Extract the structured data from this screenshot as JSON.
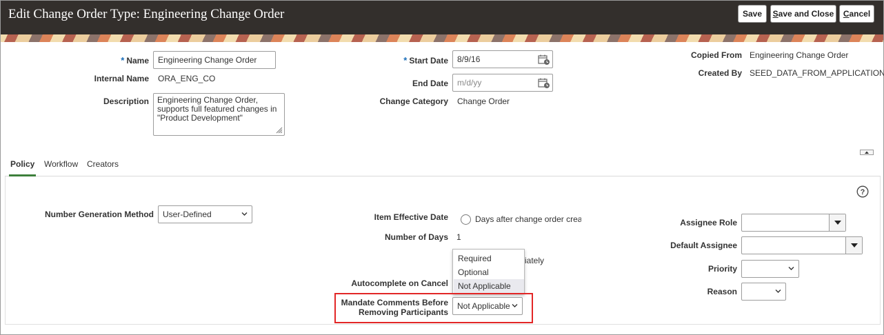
{
  "header": {
    "title": "Edit Change Order Type: Engineering Change Order",
    "buttons": {
      "save": "Save",
      "save_and_close": "Save and Close",
      "save_and_close_mnemonic": "S",
      "save_and_close_rest": "ave and Close",
      "cancel": "Cancel",
      "cancel_mnemonic": "C",
      "cancel_rest": "ancel"
    }
  },
  "form": {
    "name": {
      "label": "Name",
      "required_mark": "*",
      "value": "Engineering Change Order"
    },
    "internal_name": {
      "label": "Internal Name",
      "value": "ORA_ENG_CO"
    },
    "description": {
      "label": "Description",
      "value": "Engineering Change Order, supports full featured changes in \"Product Development\""
    },
    "start_date": {
      "label": "Start Date",
      "required_mark": "*",
      "value": "8/9/16"
    },
    "end_date": {
      "label": "End Date",
      "placeholder": "m/d/yy"
    },
    "change_category": {
      "label": "Change Category",
      "value": "Change Order"
    },
    "copied_from": {
      "label": "Copied From",
      "value": "Engineering Change Order"
    },
    "created_by": {
      "label": "Created By",
      "value": "SEED_DATA_FROM_APPLICATION"
    }
  },
  "tabs": [
    {
      "label": "Policy",
      "active": true
    },
    {
      "label": "Workflow",
      "active": false
    },
    {
      "label": "Creators",
      "active": false
    }
  ],
  "policy": {
    "number_generation_method": {
      "label": "Number Generation Method",
      "value": "User-Defined"
    },
    "item_effective_date": {
      "label": "Item Effective Date",
      "option_days_after": "Days after change order creatic",
      "option_immediately_fragment": "iately"
    },
    "number_of_days": {
      "label": "Number of Days",
      "value": "1"
    },
    "autocomplete_on_cancel": {
      "label": "Autocomplete on Cancel"
    },
    "mandate_comments": {
      "label_line1": "Mandate Comments Before",
      "label_line2": "Removing Participants",
      "value": "Not Applicable"
    },
    "dropdown_options": [
      "Required",
      "Optional",
      "Not Applicable"
    ],
    "dropdown_selected": "Not Applicable",
    "assignee_role": {
      "label": "Assignee Role",
      "value": ""
    },
    "default_assignee": {
      "label": "Default Assignee",
      "value": ""
    },
    "priority": {
      "label": "Priority",
      "value": ""
    },
    "reason": {
      "label": "Reason",
      "value": ""
    }
  },
  "colors": {
    "header_bg": "#332f2c",
    "required_mark": "#1b6fba",
    "active_tab_underline": "#3d7f3b",
    "highlight_border": "#e22626"
  },
  "icons": [
    "calendar-icon",
    "chevron-down-icon",
    "help-icon",
    "collapse-icon",
    "resize-grip-icon",
    "combo-arrow-icon"
  ]
}
